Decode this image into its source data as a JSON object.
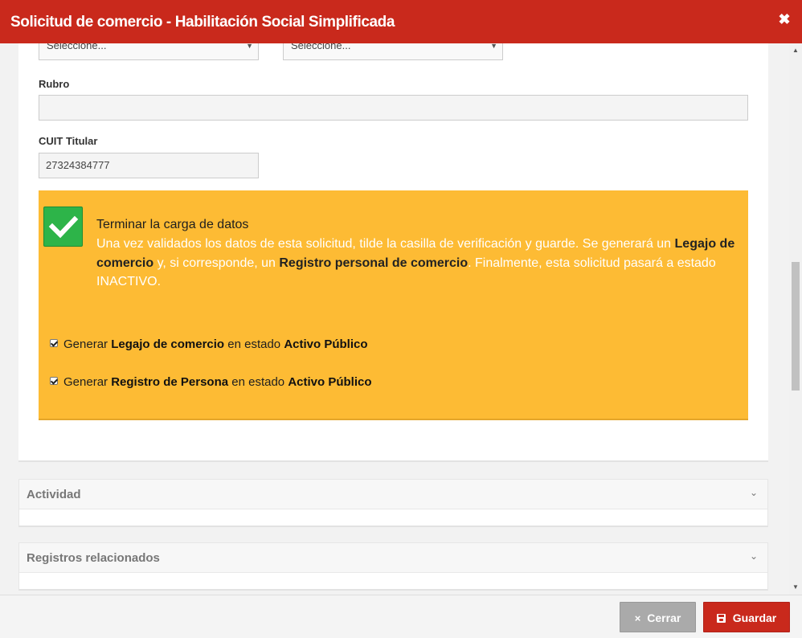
{
  "window": {
    "title": "Solicitud de comercio - Habilitación Social Simplificada",
    "close_glyph": "✖"
  },
  "form": {
    "select1": {
      "value": "Seleccione..."
    },
    "select2": {
      "value": "Seleccione..."
    },
    "rubro": {
      "label": "Rubro",
      "value": ""
    },
    "cuit": {
      "label": "CUIT Titular",
      "value": "27324384777"
    }
  },
  "notice": {
    "heading": "Terminar la carga de datos",
    "desc_part1": "Una vez validados los datos de esta solicitud, tilde la casilla de verificación y guarde. Se generará un ",
    "desc_bold1": "Legajo de comercio",
    "desc_part2": " y, si corresponde, un ",
    "desc_bold2": "Registro personal de comercio",
    "desc_part3": ". Finalmente, esta solicitud pasará a estado INACTIVO.",
    "checked": true,
    "options": [
      {
        "pre": "Generar ",
        "bold1": "Legajo de comercio",
        "mid": " en estado ",
        "bold2": "Activo Público",
        "checked": true
      },
      {
        "pre": "Generar ",
        "bold1": "Registro de Persona",
        "mid": " en estado ",
        "bold2": "Activo Público",
        "checked": true
      }
    ]
  },
  "sections": [
    {
      "title": "Actividad",
      "chevron": "⌄"
    },
    {
      "title": "Registros relacionados",
      "chevron": "⌄"
    }
  ],
  "footer": {
    "close_label": "Cerrar",
    "close_icon": "×",
    "save_label": "Guardar"
  },
  "colors": {
    "brand": "#c9291c",
    "notice_bg": "#fdbb34",
    "check_green": "#2db449"
  }
}
